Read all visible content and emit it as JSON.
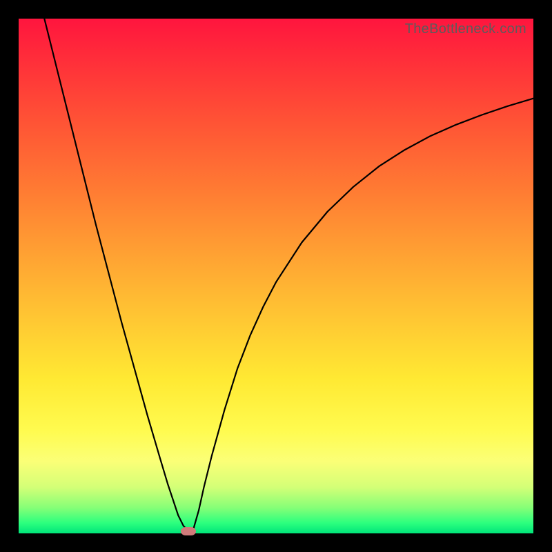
{
  "watermark": "TheBottleneck.com",
  "colors": {
    "frame": "#000000",
    "gradient_top": "#ff153e",
    "gradient_mid": "#ffe933",
    "gradient_bottom": "#00e57a",
    "curve": "#000000",
    "marker": "#cf7a7a"
  },
  "chart_data": {
    "type": "line",
    "title": "",
    "xlabel": "",
    "ylabel": "",
    "xlim": [
      0,
      100
    ],
    "ylim": [
      0,
      100
    ],
    "annotations": [],
    "series": [
      {
        "name": "curve",
        "x": [
          5.0,
          7.5,
          10.0,
          12.5,
          15.0,
          17.5,
          20.0,
          22.5,
          25.0,
          27.5,
          29.0,
          30.0,
          31.0,
          32.0,
          33.0,
          34.0,
          35.0,
          36.0,
          37.5,
          40.0,
          42.5,
          45.0,
          47.5,
          50.0,
          55.0,
          60.0,
          65.0,
          70.0,
          75.0,
          80.0,
          85.0,
          90.0,
          95.0,
          100.0
        ],
        "y": [
          100.0,
          90.0,
          80.0,
          70.0,
          60.0,
          50.5,
          41.0,
          32.0,
          23.0,
          14.5,
          9.5,
          6.5,
          3.5,
          1.5,
          0.4,
          1.0,
          4.5,
          9.0,
          15.0,
          24.0,
          32.0,
          38.5,
          44.0,
          48.8,
          56.5,
          62.5,
          67.3,
          71.3,
          74.5,
          77.2,
          79.4,
          81.3,
          83.0,
          84.5
        ]
      }
    ],
    "marker": {
      "x": 33.0,
      "y": 0.4
    },
    "grid": false,
    "legend": false
  }
}
